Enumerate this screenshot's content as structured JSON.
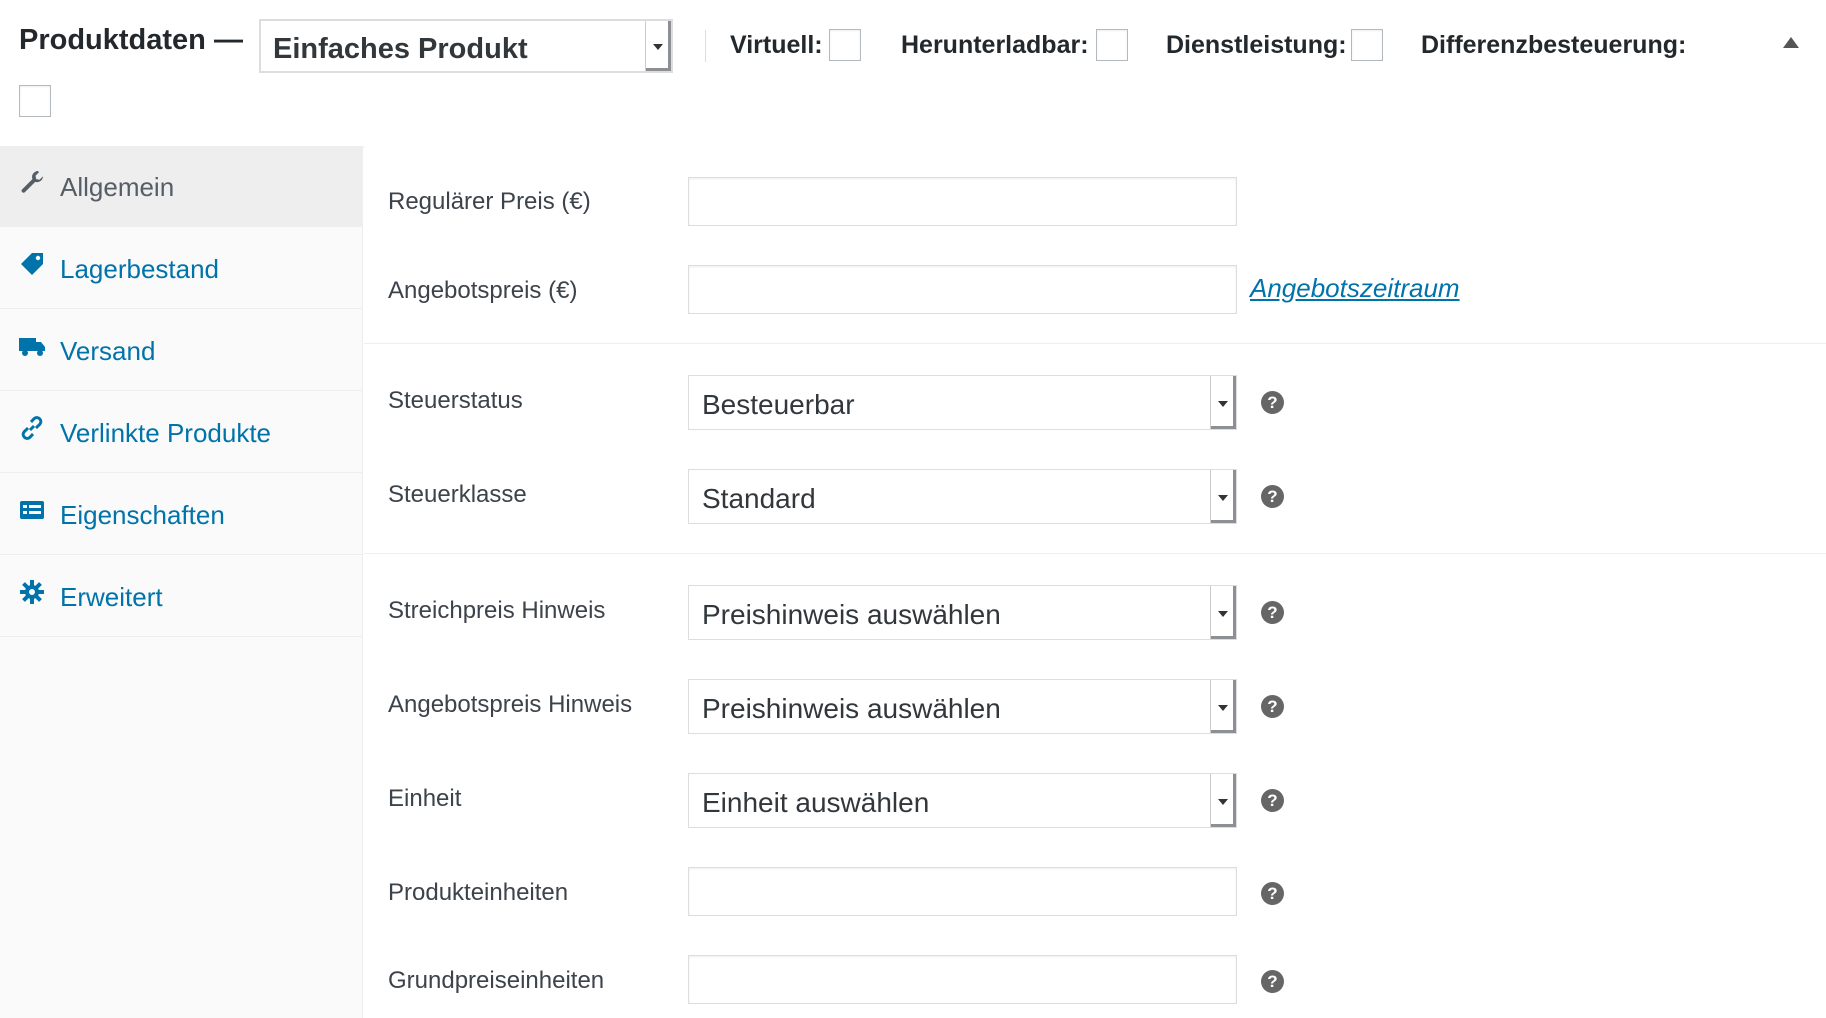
{
  "header": {
    "title": "Produktdaten —",
    "product_type": "Einfaches Produkt",
    "options": [
      {
        "label": "Virtuell:"
      },
      {
        "label": "Herunterladbar:"
      },
      {
        "label": "Dienstleistung:"
      },
      {
        "label": "Differenzbesteuerung:"
      }
    ]
  },
  "tabs": [
    {
      "label": "Allgemein",
      "icon": "wrench-icon",
      "active": true
    },
    {
      "label": "Lagerbestand",
      "icon": "tag-icon"
    },
    {
      "label": "Versand",
      "icon": "truck-icon"
    },
    {
      "label": "Verlinkte Produkte",
      "icon": "link-icon"
    },
    {
      "label": "Eigenschaften",
      "icon": "list-icon"
    },
    {
      "label": "Erweitert",
      "icon": "gear-icon"
    }
  ],
  "fields": {
    "regular_price": {
      "label": "Regulärer Preis (€)",
      "value": ""
    },
    "sale_price": {
      "label": "Angebotspreis (€)",
      "value": "",
      "schedule_link": "Angebotszeitraum"
    },
    "tax_status": {
      "label": "Steuerstatus",
      "value": "Besteuerbar"
    },
    "tax_class": {
      "label": "Steuerklasse",
      "value": "Standard"
    },
    "strike_price_notice": {
      "label": "Streichpreis Hinweis",
      "value": "Preishinweis auswählen"
    },
    "sale_price_notice": {
      "label": "Angebotspreis Hinweis",
      "value": "Preishinweis auswählen"
    },
    "unit": {
      "label": "Einheit",
      "value": "Einheit auswählen"
    },
    "product_units": {
      "label": "Produkteinheiten",
      "value": ""
    },
    "base_price_units": {
      "label": "Grundpreiseinheiten",
      "value": ""
    }
  },
  "help_glyph": "?",
  "colors": {
    "link": "#0073aa",
    "active_tab_bg": "#eeeeee",
    "sidebar_bg": "#fafafa"
  }
}
